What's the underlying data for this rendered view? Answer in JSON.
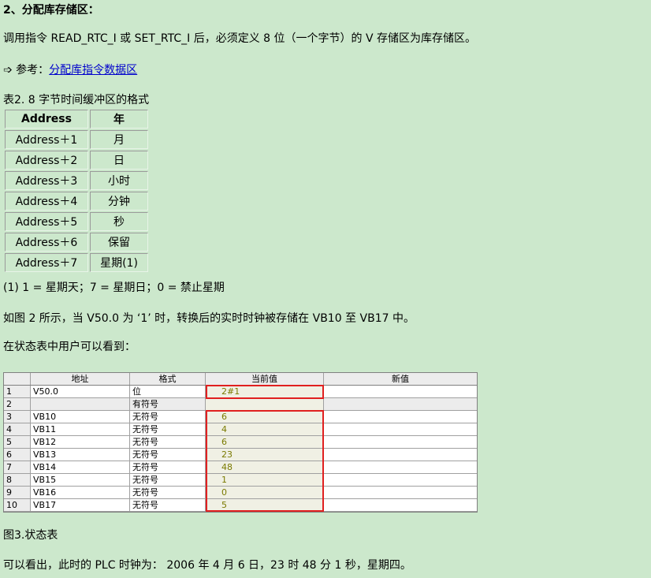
{
  "heading": "2、分配库存储区：",
  "para1": "调用指令 READ_RTC_I 或 SET_RTC_I 后，必须定义 8 位（一个字节）的 V 存储区为库存储区。",
  "reference": {
    "prefix": "➩ 参考：",
    "link": "分配库指令数据区"
  },
  "table1": {
    "caption": "表2. 8 字节时间缓冲区的格式",
    "rows": [
      [
        "Address",
        "年"
      ],
      [
        "Address＋1",
        "月"
      ],
      [
        "Address＋2",
        "日"
      ],
      [
        "Address＋3",
        "小时"
      ],
      [
        "Address＋4",
        "分钟"
      ],
      [
        "Address＋5",
        "秒"
      ],
      [
        "Address＋6",
        "保留"
      ],
      [
        "Address＋7",
        "星期(1)"
      ]
    ],
    "note": "(1) 1 = 星期天；7 = 星期日；0 = 禁止星期"
  },
  "para2": "如图 2 所示，当 V50.0 为 ‘1’ 时，转换后的实时时钟被存储在 VB10 至 VB17 中。",
  "para3": "在状态表中用户可以看到：",
  "status_table": {
    "headers": [
      "",
      "地址",
      "格式",
      "当前值",
      "新值"
    ],
    "rows": [
      [
        "1",
        "V50.0",
        "位",
        "2#1",
        ""
      ],
      [
        "2",
        "",
        "有符号",
        "",
        ""
      ],
      [
        "3",
        "VB10",
        "无符号",
        "6",
        ""
      ],
      [
        "4",
        "VB11",
        "无符号",
        "4",
        ""
      ],
      [
        "5",
        "VB12",
        "无符号",
        "6",
        ""
      ],
      [
        "6",
        "VB13",
        "无符号",
        "23",
        ""
      ],
      [
        "7",
        "VB14",
        "无符号",
        "48",
        ""
      ],
      [
        "8",
        "VB15",
        "无符号",
        "1",
        ""
      ],
      [
        "9",
        "VB16",
        "无符号",
        "0",
        ""
      ],
      [
        "10",
        "VB17",
        "无符号",
        "5",
        ""
      ]
    ],
    "highlight_color": "#e02020"
  },
  "caption2": "图3.状态表",
  "para4": "可以看出，此时的 PLC 时钟为： 2006 年 4 月 6 日，23 时 48 分 1 秒，星期四。"
}
